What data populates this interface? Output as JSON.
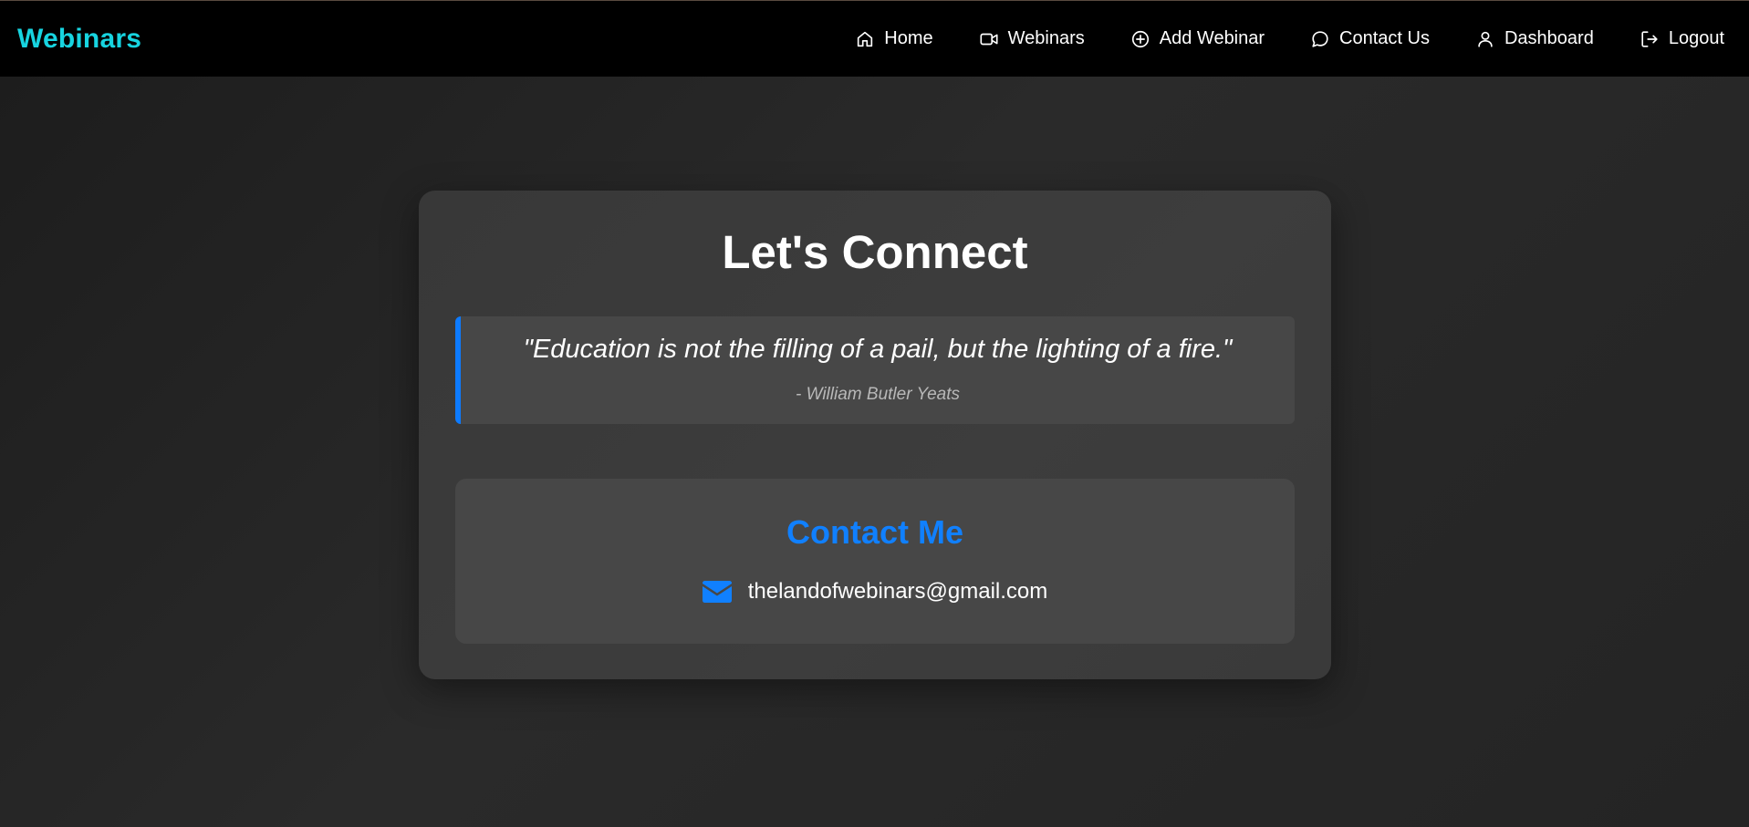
{
  "navbar": {
    "brand": "Webinars",
    "items": [
      {
        "label": "Home",
        "icon": "home-icon"
      },
      {
        "label": "Webinars",
        "icon": "video-icon"
      },
      {
        "label": "Add Webinar",
        "icon": "plus-circle-icon"
      },
      {
        "label": "Contact Us",
        "icon": "chat-bubble-icon"
      },
      {
        "label": "Dashboard",
        "icon": "user-icon"
      },
      {
        "label": "Logout",
        "icon": "logout-icon"
      }
    ]
  },
  "main": {
    "title": "Let's Connect",
    "quote": {
      "text": "\"Education is not the filling of a pail, but the lighting of a fire.\"",
      "author": "- William Butler Yeats"
    },
    "contact": {
      "title": "Contact Me",
      "email": "thelandofwebinars@gmail.com",
      "icon": "envelope-icon"
    }
  },
  "colors": {
    "brand": "#17d4e0",
    "accent": "#0d7bff",
    "navbar_bg": "#000000",
    "page_bg": "#222222",
    "card_bg": "#3a3a3a",
    "inner_box_bg": "#474747"
  }
}
